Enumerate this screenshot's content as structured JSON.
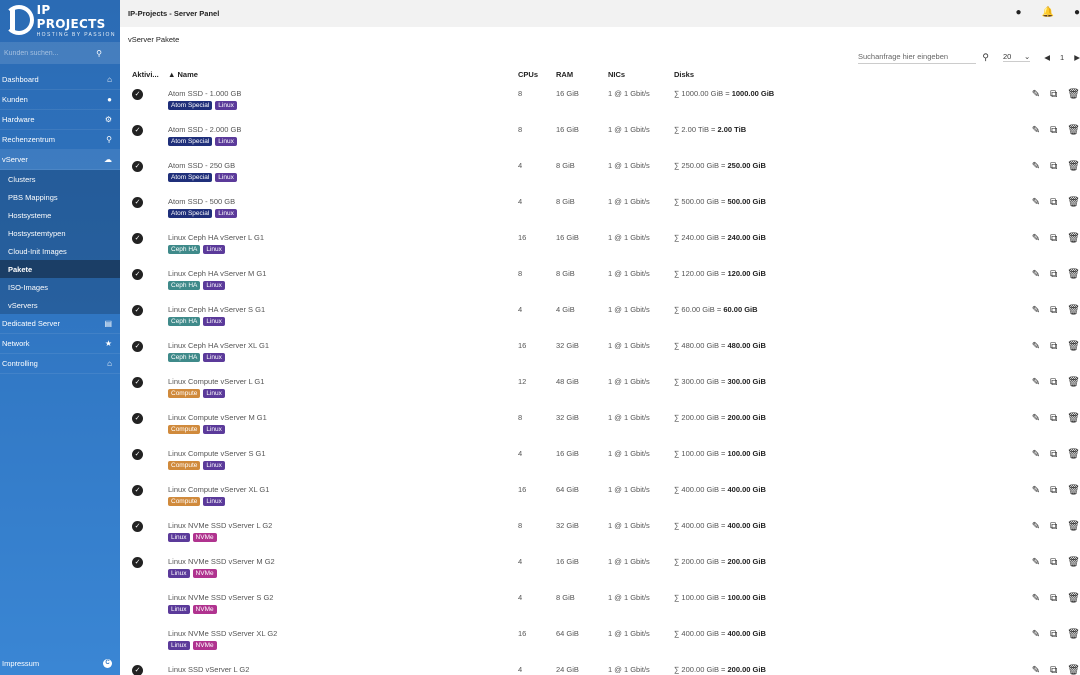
{
  "brand": {
    "title": "IP PROJECTS",
    "subtitle": "HOSTING BY PASSION"
  },
  "sidebar": {
    "search_placeholder": "Kunden suchen...",
    "items_top": [
      {
        "label": "Dashboard",
        "icon": "home-icon"
      },
      {
        "label": "Kunden",
        "icon": "users-icon"
      },
      {
        "label": "Hardware",
        "icon": "cogs-icon"
      },
      {
        "label": "Rechenzentrum",
        "icon": "map-pin-icon"
      },
      {
        "label": "vServer",
        "icon": "cloud-icon"
      }
    ],
    "vserver_sub": [
      "Clusters",
      "PBS Mappings",
      "Hostsysteme",
      "Hostsystemtypen",
      "Cloud-Init Images",
      "Pakete",
      "ISO-Images",
      "vServers"
    ],
    "active_sub": "Pakete",
    "items_bottom": [
      {
        "label": "Dedicated Server",
        "icon": "server-icon"
      },
      {
        "label": "Network",
        "icon": "share-icon"
      },
      {
        "label": "Controlling",
        "icon": "bank-icon"
      }
    ],
    "footer": {
      "label": "Impressum",
      "icon": "copyright-icon"
    }
  },
  "header": {
    "title": "IP-Projects - Server Panel"
  },
  "main": {
    "page_title": "vServer Pakete",
    "search_placeholder": "Suchanfrage hier eingeben",
    "page_size": "20",
    "page_number": "1",
    "columns": {
      "active": "Aktivi...",
      "name": "Name",
      "cpus": "CPUs",
      "ram": "RAM",
      "nics": "NICs",
      "disks": "Disks"
    },
    "rows": [
      {
        "active": true,
        "name": "Atom SSD - 1.000 GB",
        "tags": [
          "Atom Special",
          "Linux"
        ],
        "cpus": "8",
        "ram": "16 GiB",
        "nics": "1 @ 1 Gbit/s",
        "disk": "∑ 1000.00 GiB = ",
        "disk_total": "1000.00 GiB"
      },
      {
        "active": true,
        "name": "Atom SSD - 2.000 GB",
        "tags": [
          "Atom Special",
          "Linux"
        ],
        "cpus": "8",
        "ram": "16 GiB",
        "nics": "1 @ 1 Gbit/s",
        "disk": "∑ 2.00 TiB = ",
        "disk_total": "2.00 TiB"
      },
      {
        "active": true,
        "name": "Atom SSD - 250 GB",
        "tags": [
          "Atom Special",
          "Linux"
        ],
        "cpus": "4",
        "ram": "8 GiB",
        "nics": "1 @ 1 Gbit/s",
        "disk": "∑ 250.00 GiB = ",
        "disk_total": "250.00 GiB"
      },
      {
        "active": true,
        "name": "Atom SSD - 500 GB",
        "tags": [
          "Atom Special",
          "Linux"
        ],
        "cpus": "4",
        "ram": "8 GiB",
        "nics": "1 @ 1 Gbit/s",
        "disk": "∑ 500.00 GiB = ",
        "disk_total": "500.00 GiB"
      },
      {
        "active": true,
        "name": "Linux Ceph HA vServer L G1",
        "tags": [
          "Ceph HA",
          "Linux"
        ],
        "cpus": "16",
        "ram": "16 GiB",
        "nics": "1 @ 1 Gbit/s",
        "disk": "∑ 240.00 GiB = ",
        "disk_total": "240.00 GiB"
      },
      {
        "active": true,
        "name": "Linux Ceph HA vServer M G1",
        "tags": [
          "Ceph HA",
          "Linux"
        ],
        "cpus": "8",
        "ram": "8 GiB",
        "nics": "1 @ 1 Gbit/s",
        "disk": "∑ 120.00 GiB = ",
        "disk_total": "120.00 GiB"
      },
      {
        "active": true,
        "name": "Linux Ceph HA vServer S G1",
        "tags": [
          "Ceph HA",
          "Linux"
        ],
        "cpus": "4",
        "ram": "4 GiB",
        "nics": "1 @ 1 Gbit/s",
        "disk": "∑ 60.00 GiB = ",
        "disk_total": "60.00 GiB"
      },
      {
        "active": true,
        "name": "Linux Ceph HA vServer XL G1",
        "tags": [
          "Ceph HA",
          "Linux"
        ],
        "cpus": "16",
        "ram": "32 GiB",
        "nics": "1 @ 1 Gbit/s",
        "disk": "∑ 480.00 GiB = ",
        "disk_total": "480.00 GiB"
      },
      {
        "active": true,
        "name": "Linux Compute vServer L G1",
        "tags": [
          "Compute",
          "Linux"
        ],
        "cpus": "12",
        "ram": "48 GiB",
        "nics": "1 @ 1 Gbit/s",
        "disk": "∑ 300.00 GiB = ",
        "disk_total": "300.00 GiB"
      },
      {
        "active": true,
        "name": "Linux Compute vServer M G1",
        "tags": [
          "Compute",
          "Linux"
        ],
        "cpus": "8",
        "ram": "32 GiB",
        "nics": "1 @ 1 Gbit/s",
        "disk": "∑ 200.00 GiB = ",
        "disk_total": "200.00 GiB"
      },
      {
        "active": true,
        "name": "Linux Compute vServer S G1",
        "tags": [
          "Compute",
          "Linux"
        ],
        "cpus": "4",
        "ram": "16 GiB",
        "nics": "1 @ 1 Gbit/s",
        "disk": "∑ 100.00 GiB = ",
        "disk_total": "100.00 GiB"
      },
      {
        "active": true,
        "name": "Linux Compute vServer XL G1",
        "tags": [
          "Compute",
          "Linux"
        ],
        "cpus": "16",
        "ram": "64 GiB",
        "nics": "1 @ 1 Gbit/s",
        "disk": "∑ 400.00 GiB = ",
        "disk_total": "400.00 GiB"
      },
      {
        "active": true,
        "name": "Linux NVMe SSD vServer L G2",
        "tags": [
          "Linux",
          "NVMe"
        ],
        "cpus": "8",
        "ram": "32 GiB",
        "nics": "1 @ 1 Gbit/s",
        "disk": "∑ 400.00 GiB = ",
        "disk_total": "400.00 GiB"
      },
      {
        "active": true,
        "name": "Linux NVMe SSD vServer M G2",
        "tags": [
          "Linux",
          "NVMe"
        ],
        "cpus": "4",
        "ram": "16 GiB",
        "nics": "1 @ 1 Gbit/s",
        "disk": "∑ 200.00 GiB = ",
        "disk_total": "200.00 GiB"
      },
      {
        "active": false,
        "name": "Linux NVMe SSD vServer S G2",
        "tags": [
          "Linux",
          "NVMe"
        ],
        "cpus": "4",
        "ram": "8 GiB",
        "nics": "1 @ 1 Gbit/s",
        "disk": "∑ 100.00 GiB = ",
        "disk_total": "100.00 GiB"
      },
      {
        "active": false,
        "name": "Linux NVMe SSD vServer XL G2",
        "tags": [
          "Linux",
          "NVMe"
        ],
        "cpus": "16",
        "ram": "64 GiB",
        "nics": "1 @ 1 Gbit/s",
        "disk": "∑ 400.00 GiB = ",
        "disk_total": "400.00 GiB"
      },
      {
        "active": true,
        "name": "Linux SSD vServer L G2",
        "tags": [],
        "cpus": "4",
        "ram": "24 GiB",
        "nics": "1 @ 1 Gbit/s",
        "disk": "∑ 200.00 GiB = ",
        "disk_total": "200.00 GiB"
      }
    ]
  },
  "tag_colors": {
    "Atom Special": "#1f2f7a",
    "Linux": "#5b3a9a",
    "Ceph HA": "#3f8a8a",
    "Compute": "#d08a3c",
    "NVMe": "#b0338f"
  }
}
